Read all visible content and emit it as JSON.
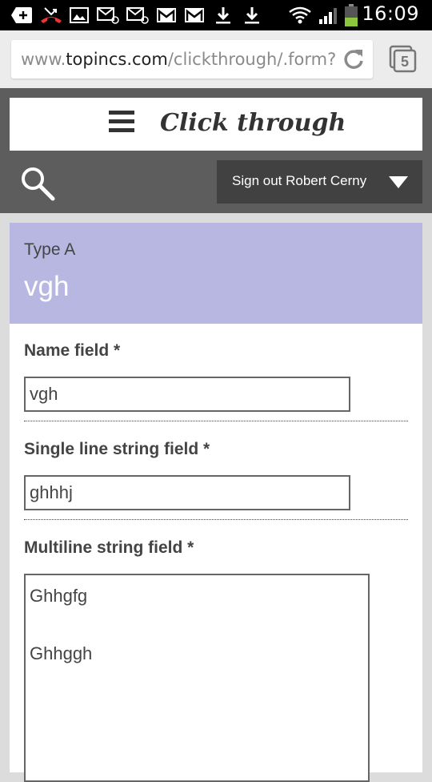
{
  "status_bar": {
    "time": "16:09",
    "icons": [
      "add-icon",
      "missed-call-icon",
      "image-icon",
      "email-icon",
      "email-icon",
      "gmail-icon",
      "gmail-icon",
      "download-icon",
      "download-icon",
      "wifi-icon",
      "signal-icon",
      "battery-icon"
    ]
  },
  "browser": {
    "url_prefix": "www.",
    "url_domain": "topincs.com",
    "url_path": "/clickthrough/.form?",
    "tab_count": "5"
  },
  "header": {
    "title": "Click through",
    "signout_label": "Sign out Robert Cerny"
  },
  "topic": {
    "type_label": "Type A",
    "title": "vgh"
  },
  "form": {
    "name_label": "Name field *",
    "name_value": "vgh",
    "single_label": "Single line string field *",
    "single_value": "ghhhj",
    "multi_label": "Multiline string field *",
    "multi_value": "Ghhgfg\n\nGhhggh"
  }
}
